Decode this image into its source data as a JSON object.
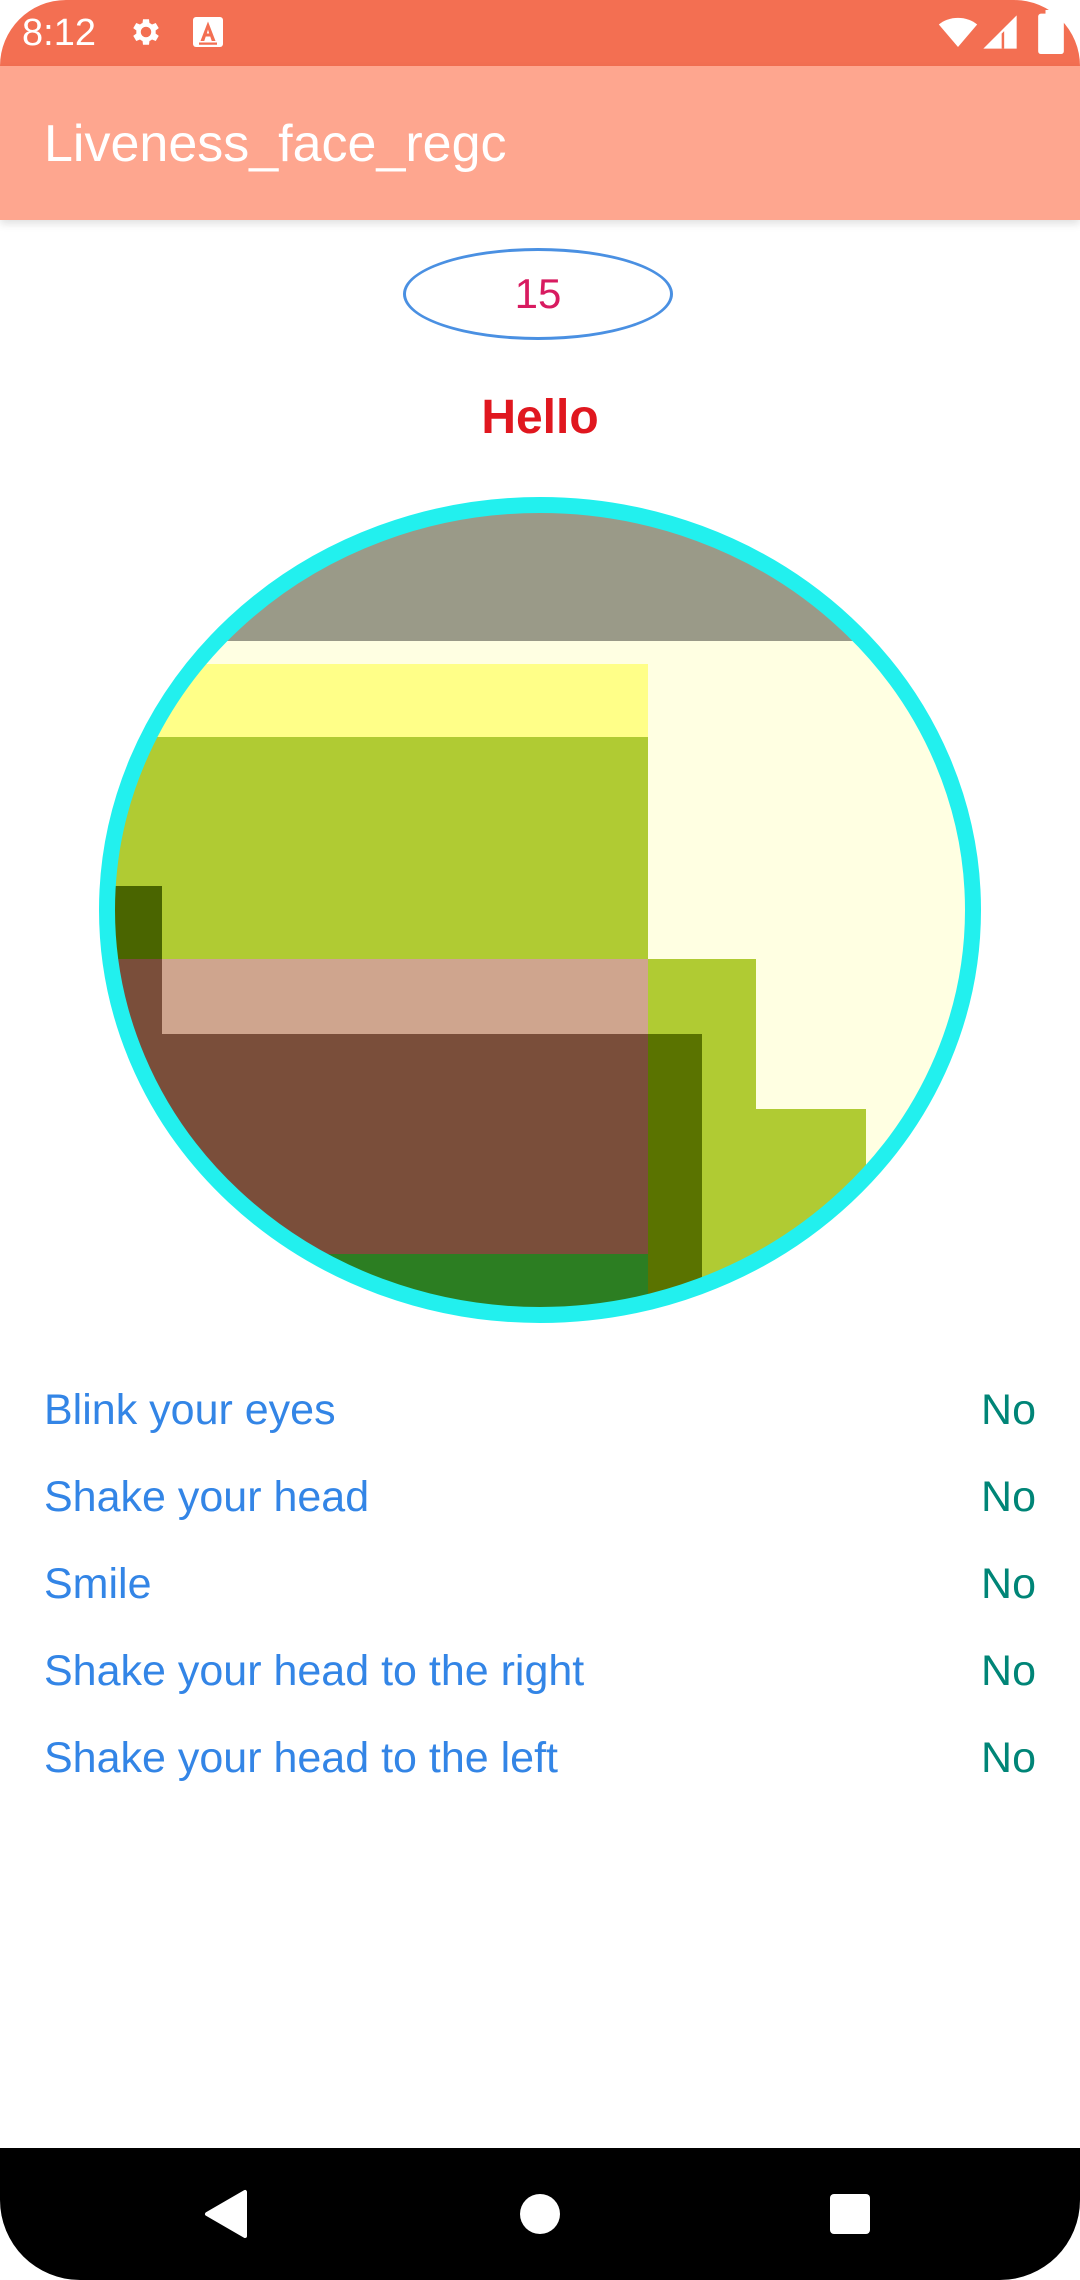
{
  "status_bar": {
    "time": "8:12",
    "icons": [
      "gear-icon",
      "keyboard-a-icon",
      "wifi-icon",
      "signal-icon",
      "battery-icon"
    ],
    "background": "#F36F52"
  },
  "app_bar": {
    "title": "Liveness_face_regc",
    "background": "#FEA68F"
  },
  "counter": {
    "value": "15"
  },
  "greeting": "Hello",
  "instructions": [
    {
      "label": "Blink your eyes",
      "status": "No"
    },
    {
      "label": "Shake your head",
      "status": "No"
    },
    {
      "label": "Smile",
      "status": "No"
    },
    {
      "label": "Shake your head to the right",
      "status": "No"
    },
    {
      "label": "Shake your head to the left",
      "status": "No"
    }
  ],
  "colors": {
    "preview_border": "#22F0EE",
    "instruction_label": "#3385E6",
    "instruction_status": "#008577",
    "greeting": "#E0171F",
    "counter_text": "#D81B60",
    "counter_border": "#4A90E2"
  },
  "nav_bar": {
    "icons": [
      "back-icon",
      "home-icon",
      "recents-icon"
    ]
  }
}
